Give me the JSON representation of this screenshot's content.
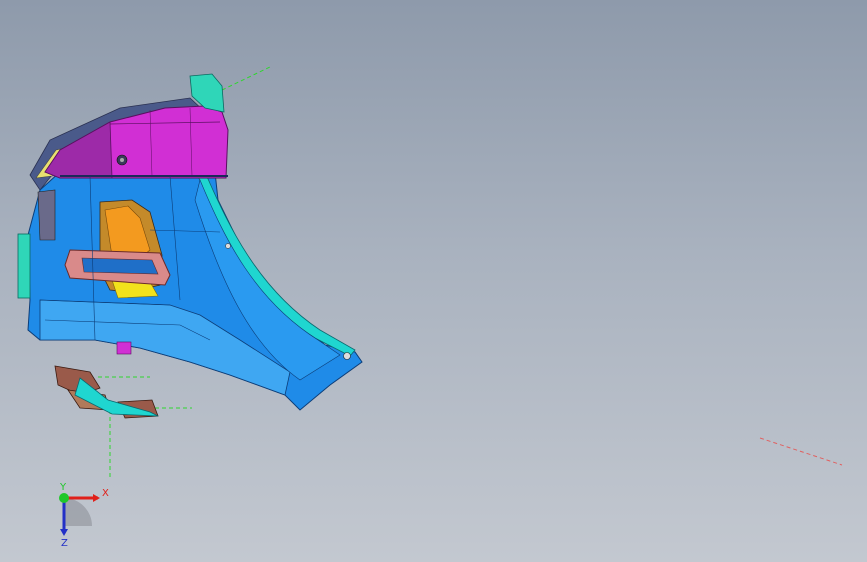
{
  "viewport": {
    "background_top": "#8e9aab",
    "background_bottom": "#c3c8d0"
  },
  "model": {
    "colors": {
      "upper_panel": "#d12fd4",
      "upper_panel_dark": "#9d2aa8",
      "main_body": "#1f8be8",
      "main_body_light": "#3fa7f2",
      "edge_trim": "#1fd6d0",
      "tab": "#2fd6b8",
      "light_orange": "#f39a1f",
      "light_yellow": "#f2e21b",
      "reflector_pink": "#d98a8a",
      "bracket_brown": "#9a5a4a",
      "grille": "#6a6a8a"
    }
  },
  "triad": {
    "x_label": "X",
    "y_label": "Y",
    "z_label": "Z",
    "x_color": "#e0201a",
    "y_color": "#1fc72a",
    "z_color": "#2330c7"
  }
}
